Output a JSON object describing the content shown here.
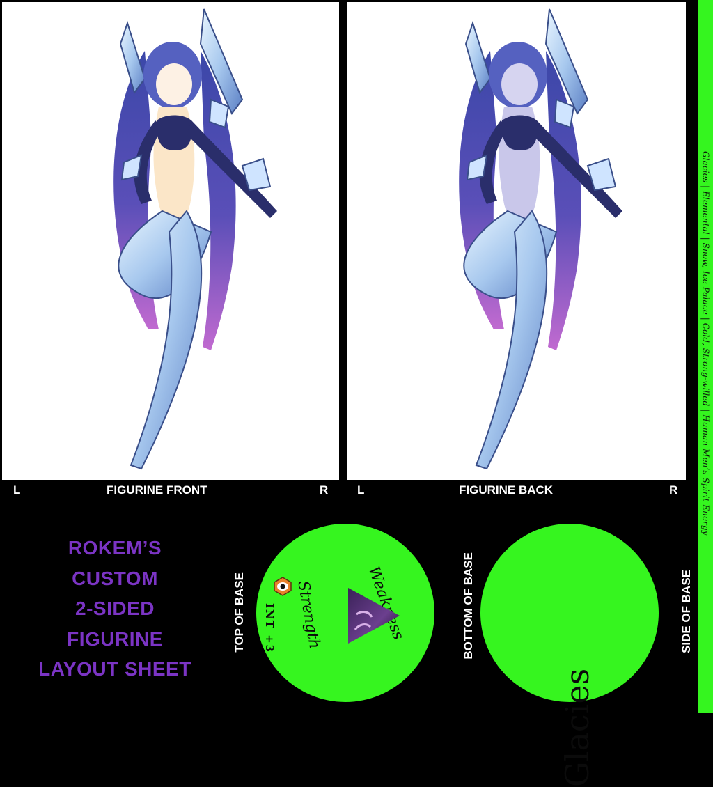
{
  "panels": {
    "front_label": "FIGURINE FRONT",
    "back_label": "FIGURINE BACK",
    "left_marker": "L",
    "right_marker": "R"
  },
  "side_strip": {
    "text": "Glacies | Elemental | Snow, Ice Palace | Cold, Strong-willed | Human Men’s Spirit Energy"
  },
  "title": {
    "lines": [
      "ROKEM’S",
      "CUSTOM",
      "2-SIDED",
      "FIGURINE",
      "LAYOUT SHEET"
    ]
  },
  "base_labels": {
    "top": "TOP OF BASE",
    "bottom": "BOTTOM OF BASE",
    "side": "SIDE OF BASE"
  },
  "top_base": {
    "weakness": "Weakness",
    "strength": "Strength",
    "stat": "INT +3",
    "icon": "owl-eye-icon"
  },
  "bottom_base": {
    "name": "Glacies"
  },
  "colors": {
    "accent_green": "#36f51f",
    "title_purple": "#7b34c4",
    "background": "#000000"
  }
}
